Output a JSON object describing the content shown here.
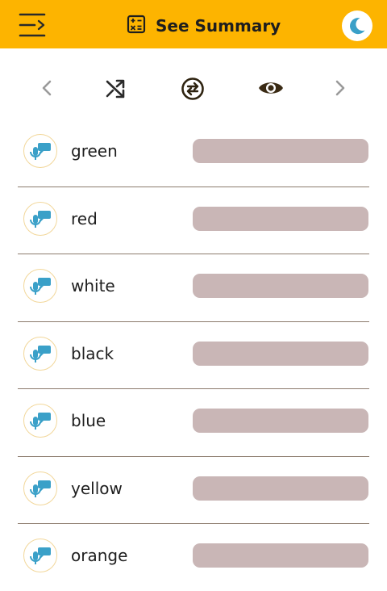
{
  "header": {
    "title": "See Summary",
    "bg_color": "#fdb400",
    "menu_icon": "menu-open-icon",
    "title_icon": "calculator-icon",
    "theme_icon": "moon-icon"
  },
  "toolbar": {
    "icons": [
      "chevron-left-icon",
      "shuffle-icon",
      "swap-icon",
      "eye-icon",
      "chevron-right-icon"
    ]
  },
  "words": [
    {
      "label": "green"
    },
    {
      "label": "red"
    },
    {
      "label": "white"
    },
    {
      "label": "black"
    },
    {
      "label": "blue"
    },
    {
      "label": "yellow"
    },
    {
      "label": "orange"
    }
  ],
  "colors": {
    "accent": "#fdb400",
    "mic_blue": "#3aa0c8",
    "answer_placeholder": "#c9b6b6",
    "divider": "#8c7b6d"
  }
}
